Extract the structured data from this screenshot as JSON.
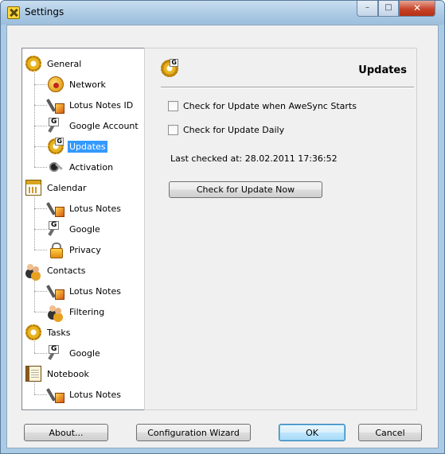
{
  "window": {
    "title": "Settings",
    "close_glyph": "✕",
    "min_glyph": "–",
    "max_glyph": "□"
  },
  "tree": {
    "items": [
      {
        "label": "General",
        "icon": "gear-icon",
        "level": 0
      },
      {
        "label": "Network",
        "icon": "globe-icon",
        "level": 1
      },
      {
        "label": "Lotus Notes ID",
        "icon": "tools-icon",
        "level": 1
      },
      {
        "label": "Google Account",
        "icon": "google-tools-icon",
        "level": 1
      },
      {
        "label": "Updates",
        "icon": "gear-g-icon",
        "level": 1,
        "selected": true
      },
      {
        "label": "Activation",
        "icon": "key-icon",
        "level": 1
      },
      {
        "label": "Calendar",
        "icon": "calendar-icon",
        "level": 0
      },
      {
        "label": "Lotus Notes",
        "icon": "tools-icon",
        "level": 1
      },
      {
        "label": "Google",
        "icon": "google-tools-icon",
        "level": 1
      },
      {
        "label": "Privacy",
        "icon": "lock-icon",
        "level": 1
      },
      {
        "label": "Contacts",
        "icon": "people-icon",
        "level": 0
      },
      {
        "label": "Lotus Notes",
        "icon": "tools-icon",
        "level": 1
      },
      {
        "label": "Filtering",
        "icon": "people-icon",
        "level": 1
      },
      {
        "label": "Tasks",
        "icon": "gear-icon",
        "level": 0
      },
      {
        "label": "Google",
        "icon": "google-tools-icon",
        "level": 1
      },
      {
        "label": "Notebook",
        "icon": "notebook-icon",
        "level": 0
      },
      {
        "label": "Lotus Notes",
        "icon": "tools-icon",
        "level": 1
      }
    ]
  },
  "panel": {
    "title": "Updates",
    "check_on_start_label": "Check for Update when AweSync Starts",
    "check_on_start_checked": false,
    "check_daily_label": "Check for Update Daily",
    "check_daily_checked": false,
    "last_checked_text": "Last checked at: 28.02.2011 17:36:52",
    "check_now_label": "Check for Update Now"
  },
  "footer": {
    "about_label": "About...",
    "wizard_label": "Configuration Wizard",
    "ok_label": "OK",
    "cancel_label": "Cancel"
  }
}
